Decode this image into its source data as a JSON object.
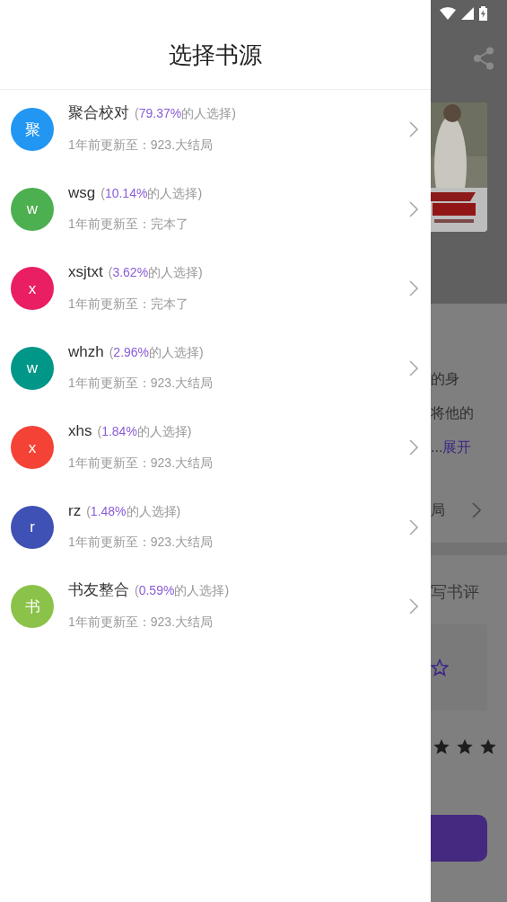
{
  "drawer": {
    "title": "选择书源",
    "sources": [
      {
        "avatar": "聚",
        "color": "#2196f3",
        "name": "聚合校对",
        "share_prefix": "(",
        "share": "79.37%",
        "share_suffix": "的人选择)",
        "update": "1年前更新至：923.大结局"
      },
      {
        "avatar": "w",
        "color": "#4caf50",
        "name": "wsg",
        "share_prefix": "(",
        "share": "10.14%",
        "share_suffix": "的人选择)",
        "update": "1年前更新至：完本了"
      },
      {
        "avatar": "x",
        "color": "#e91e63",
        "name": "xsjtxt",
        "share_prefix": "(",
        "share": "3.62%",
        "share_suffix": "的人选择)",
        "update": "1年前更新至：完本了"
      },
      {
        "avatar": "w",
        "color": "#009688",
        "name": "whzh",
        "share_prefix": "(",
        "share": "2.96%",
        "share_suffix": "的人选择)",
        "update": "1年前更新至：923.大结局"
      },
      {
        "avatar": "x",
        "color": "#f44336",
        "name": "xhs",
        "share_prefix": "(",
        "share": "1.84%",
        "share_suffix": "的人选择)",
        "update": "1年前更新至：923.大结局"
      },
      {
        "avatar": "r",
        "color": "#3f51b5",
        "name": "rz",
        "share_prefix": "(",
        "share": "1.48%",
        "share_suffix": "的人选择)",
        "update": "1年前更新至：923.大结局"
      },
      {
        "avatar": "书",
        "color": "#8bc34a",
        "name": "书友整合",
        "share_prefix": "(",
        "share": "0.59%",
        "share_suffix": "的人选择)",
        "update": "1年前更新至：923.大结局"
      }
    ]
  },
  "background_page": {
    "intro_lines": [
      "的身",
      "将他的"
    ],
    "intro_ellipsis": "...",
    "expand_link": "展开",
    "latest_chapter": "局",
    "review_prompt": "写书评"
  }
}
